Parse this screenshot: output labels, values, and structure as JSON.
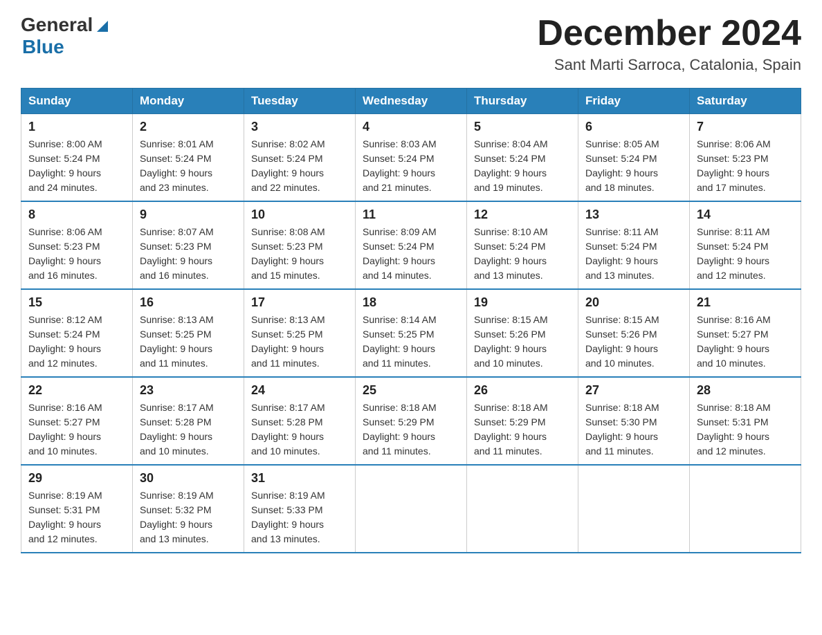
{
  "header": {
    "logo_general": "General",
    "logo_blue": "Blue",
    "month_title": "December 2024",
    "location": "Sant Marti Sarroca, Catalonia, Spain"
  },
  "weekdays": [
    "Sunday",
    "Monday",
    "Tuesday",
    "Wednesday",
    "Thursday",
    "Friday",
    "Saturday"
  ],
  "weeks": [
    [
      {
        "day": "1",
        "sunrise": "8:00 AM",
        "sunset": "5:24 PM",
        "daylight": "9 hours and 24 minutes."
      },
      {
        "day": "2",
        "sunrise": "8:01 AM",
        "sunset": "5:24 PM",
        "daylight": "9 hours and 23 minutes."
      },
      {
        "day": "3",
        "sunrise": "8:02 AM",
        "sunset": "5:24 PM",
        "daylight": "9 hours and 22 minutes."
      },
      {
        "day": "4",
        "sunrise": "8:03 AM",
        "sunset": "5:24 PM",
        "daylight": "9 hours and 21 minutes."
      },
      {
        "day": "5",
        "sunrise": "8:04 AM",
        "sunset": "5:24 PM",
        "daylight": "9 hours and 19 minutes."
      },
      {
        "day": "6",
        "sunrise": "8:05 AM",
        "sunset": "5:24 PM",
        "daylight": "9 hours and 18 minutes."
      },
      {
        "day": "7",
        "sunrise": "8:06 AM",
        "sunset": "5:23 PM",
        "daylight": "9 hours and 17 minutes."
      }
    ],
    [
      {
        "day": "8",
        "sunrise": "8:06 AM",
        "sunset": "5:23 PM",
        "daylight": "9 hours and 16 minutes."
      },
      {
        "day": "9",
        "sunrise": "8:07 AM",
        "sunset": "5:23 PM",
        "daylight": "9 hours and 16 minutes."
      },
      {
        "day": "10",
        "sunrise": "8:08 AM",
        "sunset": "5:23 PM",
        "daylight": "9 hours and 15 minutes."
      },
      {
        "day": "11",
        "sunrise": "8:09 AM",
        "sunset": "5:24 PM",
        "daylight": "9 hours and 14 minutes."
      },
      {
        "day": "12",
        "sunrise": "8:10 AM",
        "sunset": "5:24 PM",
        "daylight": "9 hours and 13 minutes."
      },
      {
        "day": "13",
        "sunrise": "8:11 AM",
        "sunset": "5:24 PM",
        "daylight": "9 hours and 13 minutes."
      },
      {
        "day": "14",
        "sunrise": "8:11 AM",
        "sunset": "5:24 PM",
        "daylight": "9 hours and 12 minutes."
      }
    ],
    [
      {
        "day": "15",
        "sunrise": "8:12 AM",
        "sunset": "5:24 PM",
        "daylight": "9 hours and 12 minutes."
      },
      {
        "day": "16",
        "sunrise": "8:13 AM",
        "sunset": "5:25 PM",
        "daylight": "9 hours and 11 minutes."
      },
      {
        "day": "17",
        "sunrise": "8:13 AM",
        "sunset": "5:25 PM",
        "daylight": "9 hours and 11 minutes."
      },
      {
        "day": "18",
        "sunrise": "8:14 AM",
        "sunset": "5:25 PM",
        "daylight": "9 hours and 11 minutes."
      },
      {
        "day": "19",
        "sunrise": "8:15 AM",
        "sunset": "5:26 PM",
        "daylight": "9 hours and 10 minutes."
      },
      {
        "day": "20",
        "sunrise": "8:15 AM",
        "sunset": "5:26 PM",
        "daylight": "9 hours and 10 minutes."
      },
      {
        "day": "21",
        "sunrise": "8:16 AM",
        "sunset": "5:27 PM",
        "daylight": "9 hours and 10 minutes."
      }
    ],
    [
      {
        "day": "22",
        "sunrise": "8:16 AM",
        "sunset": "5:27 PM",
        "daylight": "9 hours and 10 minutes."
      },
      {
        "day": "23",
        "sunrise": "8:17 AM",
        "sunset": "5:28 PM",
        "daylight": "9 hours and 10 minutes."
      },
      {
        "day": "24",
        "sunrise": "8:17 AM",
        "sunset": "5:28 PM",
        "daylight": "9 hours and 10 minutes."
      },
      {
        "day": "25",
        "sunrise": "8:18 AM",
        "sunset": "5:29 PM",
        "daylight": "9 hours and 11 minutes."
      },
      {
        "day": "26",
        "sunrise": "8:18 AM",
        "sunset": "5:29 PM",
        "daylight": "9 hours and 11 minutes."
      },
      {
        "day": "27",
        "sunrise": "8:18 AM",
        "sunset": "5:30 PM",
        "daylight": "9 hours and 11 minutes."
      },
      {
        "day": "28",
        "sunrise": "8:18 AM",
        "sunset": "5:31 PM",
        "daylight": "9 hours and 12 minutes."
      }
    ],
    [
      {
        "day": "29",
        "sunrise": "8:19 AM",
        "sunset": "5:31 PM",
        "daylight": "9 hours and 12 minutes."
      },
      {
        "day": "30",
        "sunrise": "8:19 AM",
        "sunset": "5:32 PM",
        "daylight": "9 hours and 13 minutes."
      },
      {
        "day": "31",
        "sunrise": "8:19 AM",
        "sunset": "5:33 PM",
        "daylight": "9 hours and 13 minutes."
      },
      null,
      null,
      null,
      null
    ]
  ],
  "labels": {
    "sunrise": "Sunrise:",
    "sunset": "Sunset:",
    "daylight": "Daylight:"
  }
}
